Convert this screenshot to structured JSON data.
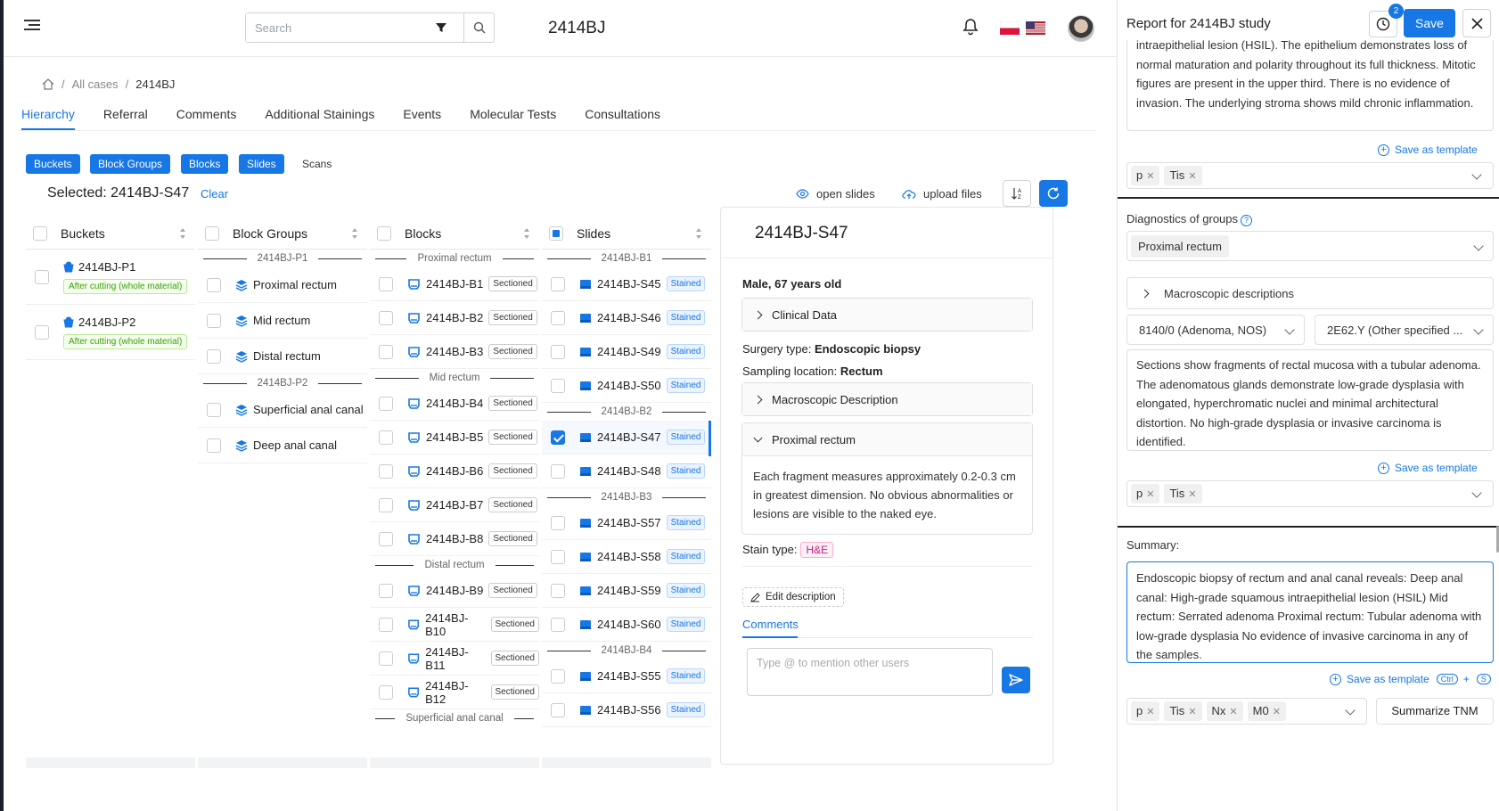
{
  "topbar": {
    "search_placeholder": "Search",
    "study_title": "2414BJ"
  },
  "breadcrumb": {
    "items": [
      "All cases",
      "2414BJ"
    ]
  },
  "tabs": [
    "Hierarchy",
    "Referral",
    "Comments",
    "Additional Stainings",
    "Events",
    "Molecular Tests",
    "Consultations"
  ],
  "levels": [
    "Buckets",
    "Block Groups",
    "Blocks",
    "Slides",
    "Scans"
  ],
  "selection": {
    "label": "Selected: 2414BJ-S47",
    "clear": "Clear"
  },
  "actions": {
    "open_slides": "open slides",
    "upload_files": "upload files"
  },
  "columns": {
    "buckets": {
      "header": "Buckets",
      "items": [
        {
          "name": "2414BJ-P1",
          "tag": "After cutting (whole material)"
        },
        {
          "name": "2414BJ-P2",
          "tag": "After cutting (whole material)"
        }
      ]
    },
    "block_groups": {
      "header": "Block Groups",
      "groups": [
        {
          "label": "2414BJ-P1",
          "items": [
            "Proximal rectum",
            "Mid rectum",
            "Distal rectum"
          ]
        },
        {
          "label": "2414BJ-P2",
          "items": [
            "Superficial anal canal",
            "Deep anal canal"
          ]
        }
      ]
    },
    "blocks": {
      "header": "Blocks",
      "status": "Sectioned",
      "groups": [
        {
          "label": "Proximal rectum",
          "items": [
            "2414BJ-B1",
            "2414BJ-B2",
            "2414BJ-B3"
          ]
        },
        {
          "label": "Mid rectum",
          "items": [
            "2414BJ-B4",
            "2414BJ-B5",
            "2414BJ-B6",
            "2414BJ-B7",
            "2414BJ-B8"
          ]
        },
        {
          "label": "Distal rectum",
          "items": [
            "2414BJ-B9",
            "2414BJ-B10",
            "2414BJ-B11",
            "2414BJ-B12"
          ]
        },
        {
          "label": "Superficial anal canal",
          "items": []
        }
      ]
    },
    "slides": {
      "header": "Slides",
      "status": "Stained",
      "groups": [
        {
          "label": "2414BJ-B1",
          "items": [
            "2414BJ-S45",
            "2414BJ-S46",
            "2414BJ-S49",
            "2414BJ-S50"
          ]
        },
        {
          "label": "2414BJ-B2",
          "items": [
            "2414BJ-S47",
            "2414BJ-S48"
          ]
        },
        {
          "label": "2414BJ-B3",
          "items": [
            "2414BJ-S57",
            "2414BJ-S58",
            "2414BJ-S59",
            "2414BJ-S60"
          ]
        },
        {
          "label": "2414BJ-B4",
          "items": [
            "2414BJ-S55",
            "2414BJ-S56"
          ]
        }
      ],
      "selected": "2414BJ-S47"
    }
  },
  "detail": {
    "title": "2414BJ-S47",
    "patient": "Male, 67 years old",
    "clinical_data": "Clinical Data",
    "surgery_label": "Surgery type:",
    "surgery_value": "Endoscopic biopsy",
    "sampling_label": "Sampling location:",
    "sampling_value": "Rectum",
    "macro_label": "Macroscopic Description",
    "group_label": "Proximal rectum",
    "group_text": "Each fragment measures approximately 0.2-0.3 cm in greatest dimension. No obvious abnormalities or lesions are visible to the naked eye.",
    "stain_label": "Stain type:",
    "stain_value": "H&E",
    "edit_label": "Edit description",
    "comments_label": "Comments",
    "comment_placeholder": "Type @ to mention other users"
  },
  "report": {
    "title": "Report for 2414BJ study",
    "history_count": "2",
    "save": "Save",
    "top_text": "intraepithelial lesion (HSIL). The epithelium demonstrates loss of normal maturation and polarity throughout its full thickness. Mitotic figures are present in the upper third. There is no evidence of invasion. The underlying stroma shows mild chronic inflammation.",
    "save_template": "Save as template",
    "tags1": [
      "p",
      "Tis"
    ],
    "diag_groups_label": "Diagnostics of groups",
    "group_select": "Proximal rectum",
    "macro_desc": "Macroscopic descriptions",
    "icd_o": "8140/0 (Adenoma, NOS)",
    "icd_11": "2E62.Y (Other specified ...",
    "group_text": "Sections show fragments of rectal mucosa with a tubular adenoma. The adenomatous glands demonstrate low-grade dysplasia with elongated, hyperchromatic nuclei and minimal architectural distortion. No high-grade dysplasia or invasive carcinoma is identified.",
    "tags2": [
      "p",
      "Tis"
    ],
    "summary_label": "Summary:",
    "summary_text": "Endoscopic biopsy of rectum and anal canal reveals: Deep anal canal: High-grade squamous intraepithelial lesion (HSIL) Mid rectum: Serrated adenoma Proximal rectum: Tubular adenoma with low-grade dysplasia No evidence of invasive carcinoma in any of the samples.",
    "kbd_ctrl": "Ctrl",
    "kbd_plus": "+",
    "kbd_s": "S",
    "tags3": [
      "p",
      "Tis",
      "Nx",
      "M0"
    ],
    "summarize_tnm": "Summarize TNM"
  },
  "colors": {
    "accent": "#1677e5",
    "sidebar": "#1b1f2a"
  }
}
